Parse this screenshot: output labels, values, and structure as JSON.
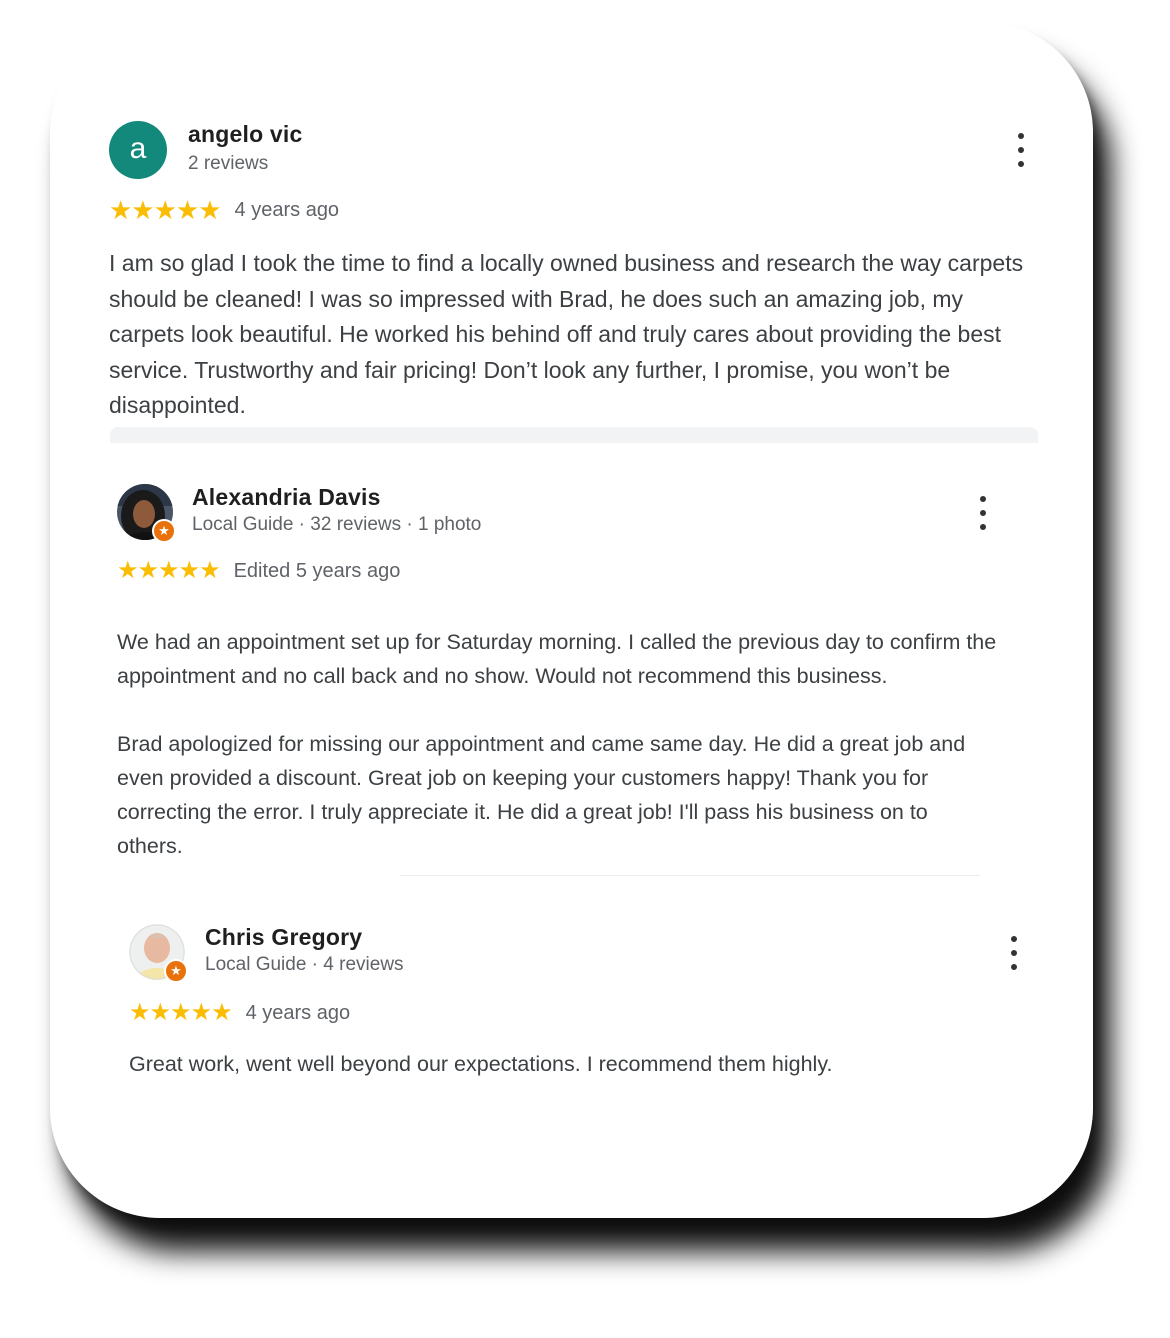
{
  "reviews": [
    {
      "name": "angelo vic",
      "avatar_letter": "a",
      "meta": "2 reviews",
      "stars": "★★★★★",
      "when": "4 years ago",
      "text": [
        "I am so glad I took the time to find a locally owned business and research the way carpets should be cleaned! I was so impressed with Brad, he does such an amazing job, my carpets look beautiful. He worked his behind off and truly cares about providing the best service. Trustworthy and fair pricing! Don’t look any further, I promise, you won’t be disappointed."
      ]
    },
    {
      "name": "Alexandria Davis",
      "meta": "Local Guide · 32 reviews · 1 photo",
      "stars": "★★★★★",
      "when": "Edited 5 years ago",
      "text": [
        "We had an appointment set up for Saturday morning. I called the previous day to confirm the appointment and no call back and no show. Would not recommend this business.",
        "Brad apologized for missing our appointment and came same day. He did a great job and even provided a discount. Great job on keeping your customers happy! Thank you for correcting the error. I truly appreciate it. He did a great job! I'll pass his business on to others."
      ]
    },
    {
      "name": "Chris Gregory",
      "meta": "Local Guide · 4 reviews",
      "stars": "★★★★★",
      "when": "4 years ago",
      "text": [
        "Great work, went well beyond our expectations. I recommend them highly."
      ]
    }
  ],
  "colors": {
    "star": "#fbbc04",
    "avatar_green": "#12897b",
    "local_guide_badge": "#e8710a"
  },
  "icons": {
    "more": "more-vert-icon",
    "badge": "local-guide-badge-icon"
  }
}
